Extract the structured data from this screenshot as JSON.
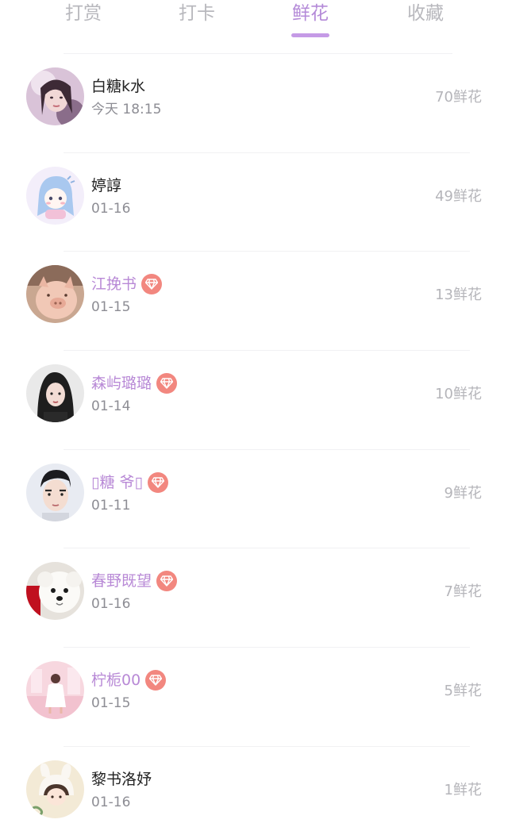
{
  "tabs": [
    {
      "label": "打赏",
      "active": false
    },
    {
      "label": "打卡",
      "active": false
    },
    {
      "label": "鲜花",
      "active": true
    },
    {
      "label": "收藏",
      "active": false
    }
  ],
  "colors": {
    "accent": "#b48ad8",
    "vip_name": "#b889d6",
    "gem_badge": "#f2877f",
    "muted_text": "#b5b5ba"
  },
  "rows": [
    {
      "name": "白糖k水",
      "date": "今天 18:15",
      "amount": "70鲜花",
      "vip": false,
      "avatar_icon": "girl-portrait-avatar"
    },
    {
      "name": "婷諄",
      "date": "01-16",
      "amount": "49鲜花",
      "vip": false,
      "avatar_icon": "cartoon-girl-avatar"
    },
    {
      "name": "江挽书",
      "date": "01-15",
      "amount": "13鲜花",
      "vip": true,
      "avatar_icon": "plush-pig-avatar"
    },
    {
      "name": "森屿璐璐",
      "date": "01-14",
      "amount": "10鲜花",
      "vip": true,
      "avatar_icon": "girl-dark-hair-avatar"
    },
    {
      "name": "▯糖 爷▯",
      "date": "01-11",
      "amount": "9鲜花",
      "vip": true,
      "avatar_icon": "boy-portrait-avatar"
    },
    {
      "name": "春野既望",
      "date": "01-16",
      "amount": "7鲜花",
      "vip": true,
      "avatar_icon": "white-dog-avatar"
    },
    {
      "name": "柠栀00",
      "date": "01-15",
      "amount": "5鲜花",
      "vip": true,
      "avatar_icon": "pink-room-avatar"
    },
    {
      "name": "黎书洛妤",
      "date": "01-16",
      "amount": "1鲜花",
      "vip": false,
      "avatar_icon": "bunny-hat-girl-avatar"
    }
  ]
}
